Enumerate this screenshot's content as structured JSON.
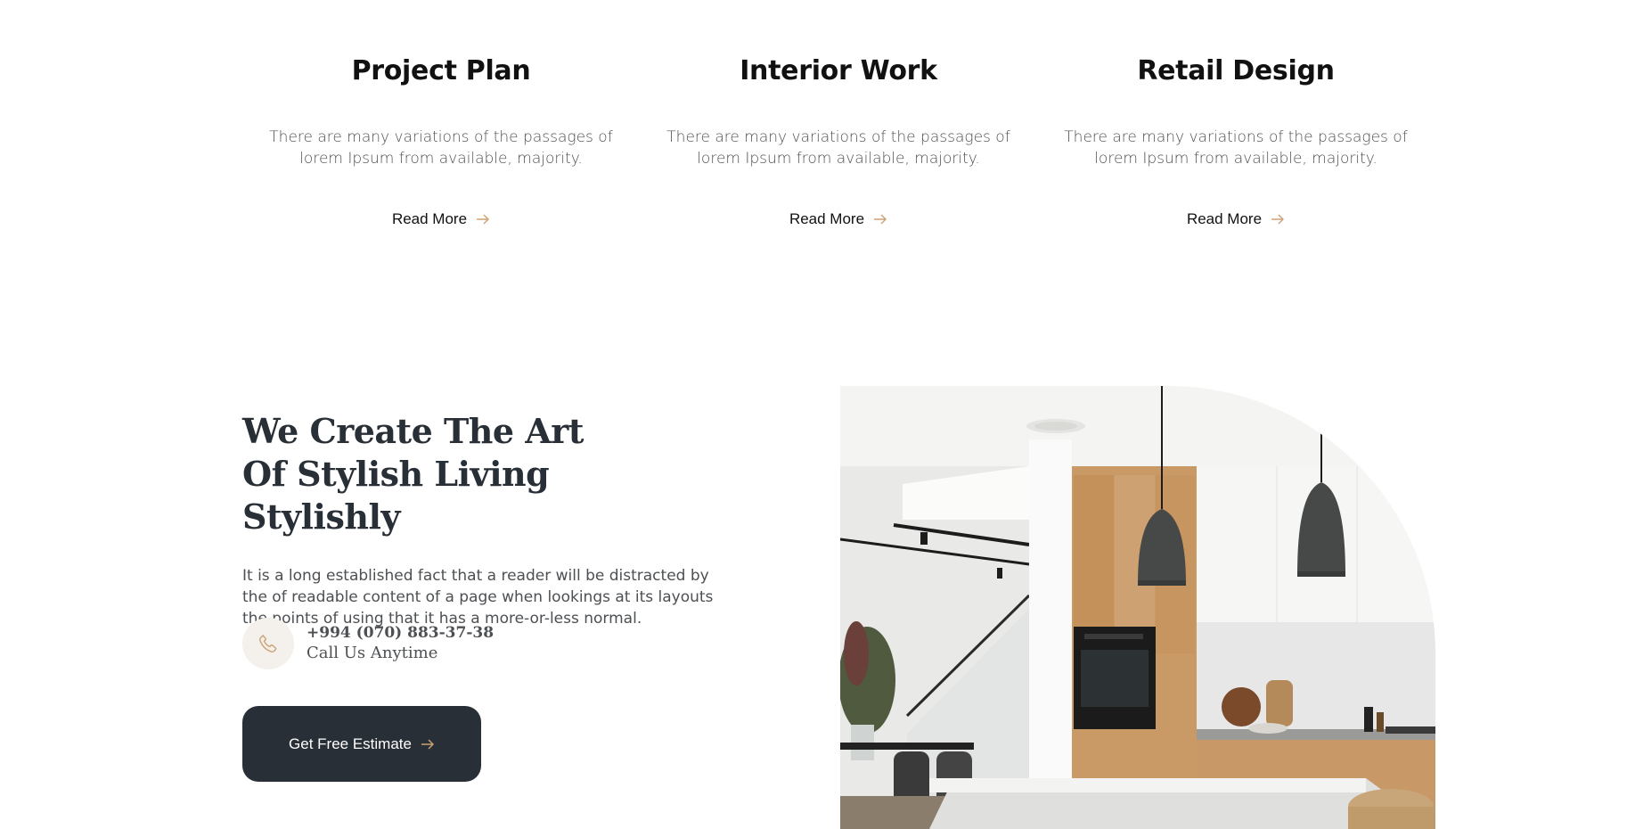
{
  "services": [
    {
      "title": "Project Plan",
      "description": "There are many variations of the passages of lorem Ipsum from available, majority.",
      "link": "Read More"
    },
    {
      "title": "Interior Work",
      "description": "There are many variations of the passages of lorem Ipsum from available, majority.",
      "link": "Read More"
    },
    {
      "title": "Retail Design",
      "description": "There are many variations of the passages of lorem Ipsum from available, majority.",
      "link": "Read More"
    }
  ],
  "about": {
    "title": "We Create The Art Of Stylish Living Stylishly",
    "description": "It is a long established fact that a reader will be distracted by the of readable content of a page when lookings at its layouts the points of using that it has a more-or-less normal.",
    "phone": "+994 (070) 883-37-38",
    "phone_caption": "Call Us Anytime",
    "cta_label": "Get Free Estimate"
  },
  "icons": {
    "arrow": "arrow-right-icon",
    "phone": "phone-icon"
  },
  "colors": {
    "dark": "#292F36",
    "accent": "#CDA274",
    "text_muted": "#4D5053",
    "icon_bg": "#F4F0EC"
  }
}
